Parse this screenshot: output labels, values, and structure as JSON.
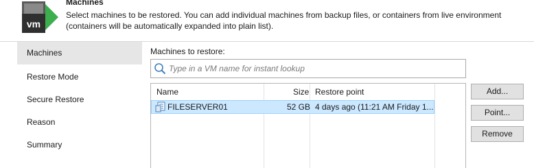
{
  "header": {
    "title": "Machines",
    "description": "Select machines to be restored. You can add individual machines from backup files, or containers from live environment (containers will be automatically expanded into plain list).",
    "icon": "vm-icon",
    "icon_label": "vm",
    "accent_color": "#3cae4e"
  },
  "sidebar": {
    "items": [
      {
        "label": "Machines",
        "active": true
      },
      {
        "label": "Restore Mode",
        "active": false
      },
      {
        "label": "Secure Restore",
        "active": false
      },
      {
        "label": "Reason",
        "active": false
      },
      {
        "label": "Summary",
        "active": false
      }
    ]
  },
  "main": {
    "label": "Machines to restore:",
    "search": {
      "placeholder": "Type in a VM name for instant lookup",
      "value": "",
      "icon": "search-icon"
    },
    "table": {
      "columns": [
        "Name",
        "Size",
        "Restore point"
      ],
      "rows": [
        {
          "name": "FILESERVER01",
          "size": "52 GB",
          "restore_point": "4 days ago (11:21 AM Friday 1...",
          "icon": "server-icon",
          "selected": true
        }
      ]
    },
    "buttons": {
      "add": "Add...",
      "point": "Point...",
      "remove": "Remove"
    }
  }
}
